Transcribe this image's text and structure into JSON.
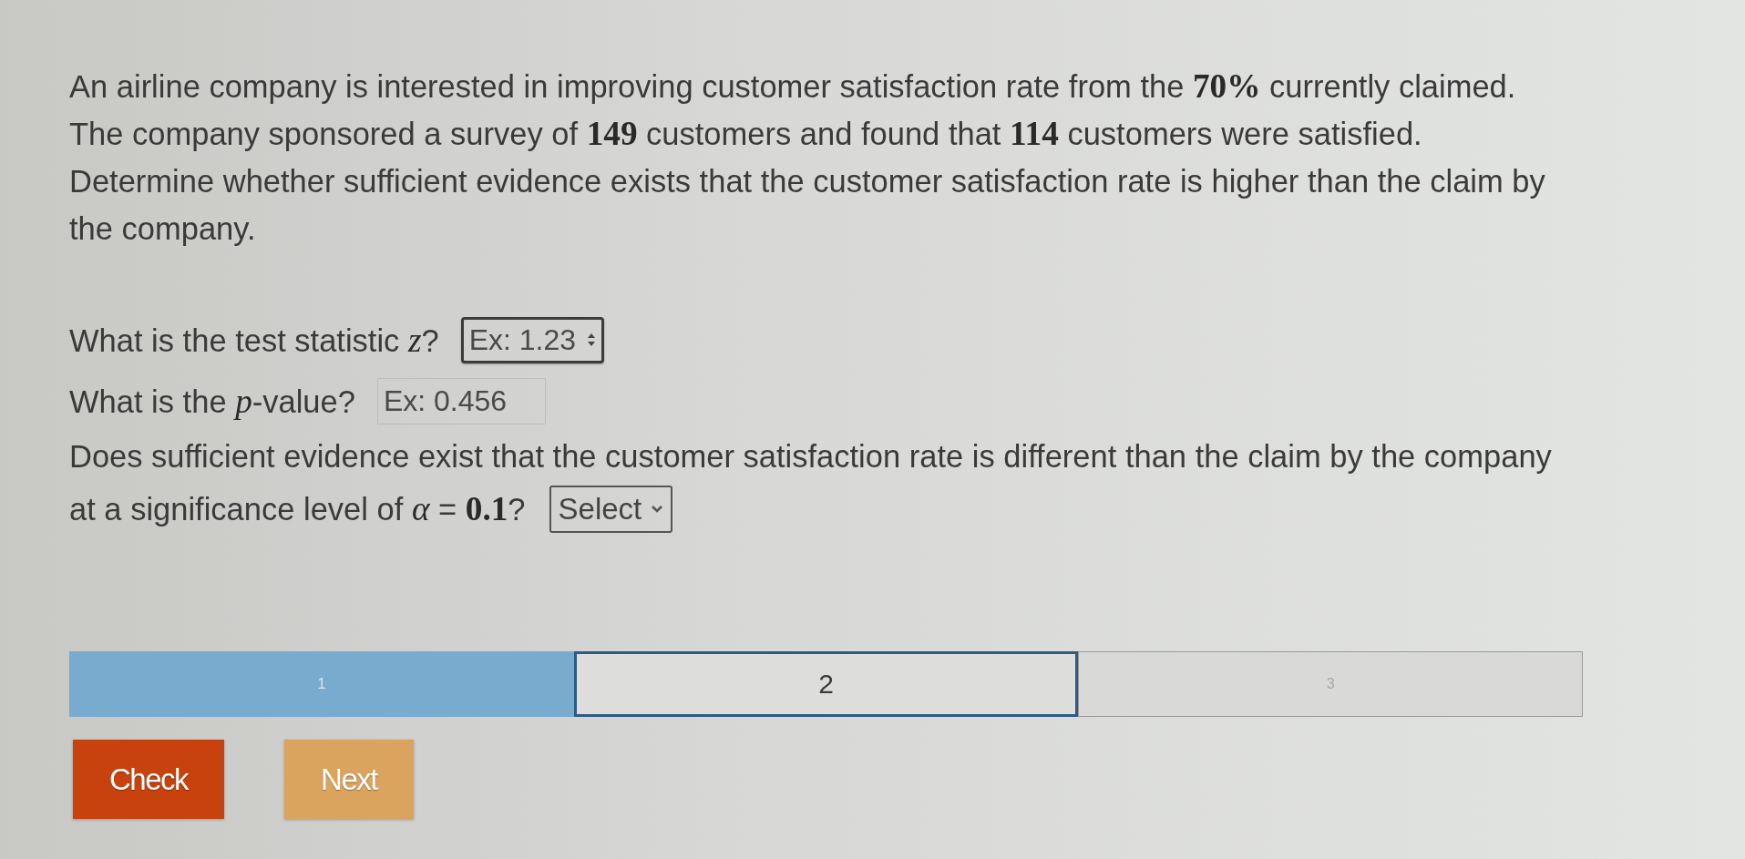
{
  "problem": {
    "sentences": [
      "An airline company is interested in improving customer satisfaction rate from the **70%** currently claimed.",
      "The company sponsored a survey of **149** customers and found that **114** customers were satisfied.",
      "Determine whether sufficient evidence exists that the customer satisfaction rate is higher than the claim by the company."
    ]
  },
  "questions": [
    {
      "kind": "number",
      "label": [
        "What is the test statistic *z*?"
      ],
      "placeholder": "Ex: 1.23",
      "focused": true
    },
    {
      "kind": "text",
      "label": [
        "What is the *p*-value?"
      ],
      "placeholder": "Ex: 0.456",
      "focused": false
    },
    {
      "kind": "select",
      "label": [
        "Does sufficient evidence exist that the customer satisfaction rate is different than the claim by the company",
        "at a significance level of *α* = **0.1**?"
      ],
      "value": "Select"
    }
  ],
  "levels": [
    {
      "label": "1",
      "completed": true,
      "selected": false
    },
    {
      "label": "2",
      "completed": false,
      "selected": true
    },
    {
      "label": "3",
      "completed": false,
      "selected": false
    }
  ],
  "buttons": [
    {
      "label": "Check",
      "kind": "primary",
      "disabled": false
    },
    {
      "label": "Next",
      "kind": "primary",
      "disabled": true
    }
  ]
}
